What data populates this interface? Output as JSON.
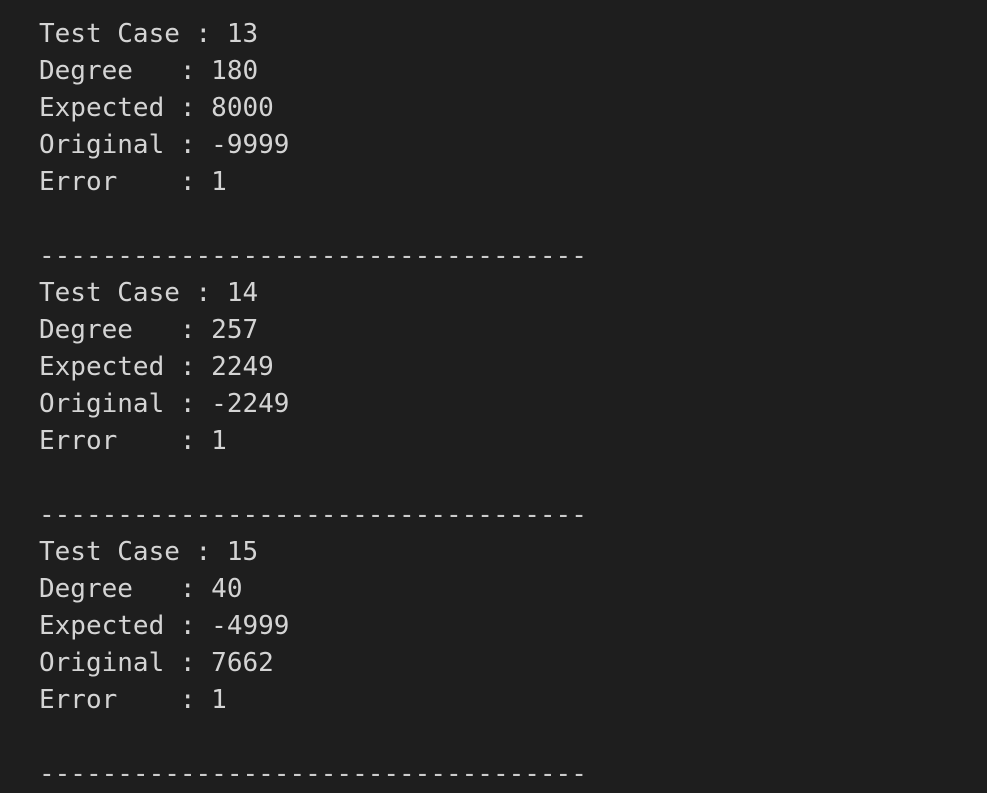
{
  "terminal": {
    "blocks": [
      {
        "lines": [
          "Test Case : 13",
          "Degree   : 180",
          "Expected : 8000",
          "Original : -9999",
          "Error    : 1"
        ],
        "separator": "-----------------------------------"
      },
      {
        "lines": [
          "Test Case : 14",
          "Degree   : 257",
          "Expected : 2249",
          "Original : -2249",
          "Error    : 1"
        ],
        "separator": "-----------------------------------"
      },
      {
        "lines": [
          "Test Case : 15",
          "Degree   : 40",
          "Expected : -4999",
          "Original : 7662",
          "Error    : 1"
        ],
        "separator": "-----------------------------------"
      }
    ]
  }
}
